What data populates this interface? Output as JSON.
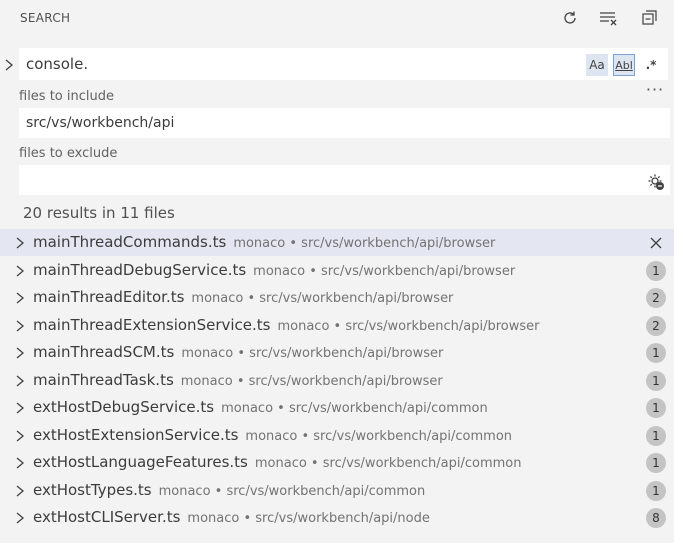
{
  "header": {
    "title": "SEARCH",
    "refresh_icon": "refresh-icon",
    "clear_icon": "clear-results-icon",
    "collapse_icon": "collapse-all-icon"
  },
  "search": {
    "query": "console.",
    "match_case_label": "Aa",
    "whole_word_label": "Abl",
    "regex_label": ".*",
    "more_label": "···"
  },
  "include": {
    "label": "files to include",
    "value": "src/vs/workbench/api"
  },
  "exclude": {
    "label": "files to exclude",
    "value": "",
    "settings_icon": "use-exclude-settings-icon"
  },
  "summary": "20 results in 11 files",
  "results": [
    {
      "file": "mainThreadCommands.ts",
      "path": "monaco • src/vs/workbench/api/browser",
      "count": ""
    },
    {
      "file": "mainThreadDebugService.ts",
      "path": "monaco • src/vs/workbench/api/browser",
      "count": "1"
    },
    {
      "file": "mainThreadEditor.ts",
      "path": "monaco • src/vs/workbench/api/browser",
      "count": "2"
    },
    {
      "file": "mainThreadExtensionService.ts",
      "path": "monaco • src/vs/workbench/api/browser",
      "count": "2"
    },
    {
      "file": "mainThreadSCM.ts",
      "path": "monaco • src/vs/workbench/api/browser",
      "count": "1"
    },
    {
      "file": "mainThreadTask.ts",
      "path": "monaco • src/vs/workbench/api/browser",
      "count": "1"
    },
    {
      "file": "extHostDebugService.ts",
      "path": "monaco • src/vs/workbench/api/common",
      "count": "1"
    },
    {
      "file": "extHostExtensionService.ts",
      "path": "monaco • src/vs/workbench/api/common",
      "count": "1"
    },
    {
      "file": "extHostLanguageFeatures.ts",
      "path": "monaco • src/vs/workbench/api/common",
      "count": "1"
    },
    {
      "file": "extHostTypes.ts",
      "path": "monaco • src/vs/workbench/api/common",
      "count": "1"
    },
    {
      "file": "extHostCLIServer.ts",
      "path": "monaco • src/vs/workbench/api/node",
      "count": "8"
    }
  ],
  "colors": {
    "background": "#f3f3f3",
    "selected_row": "#e4e6f1",
    "badge": "#c4c4c4"
  }
}
